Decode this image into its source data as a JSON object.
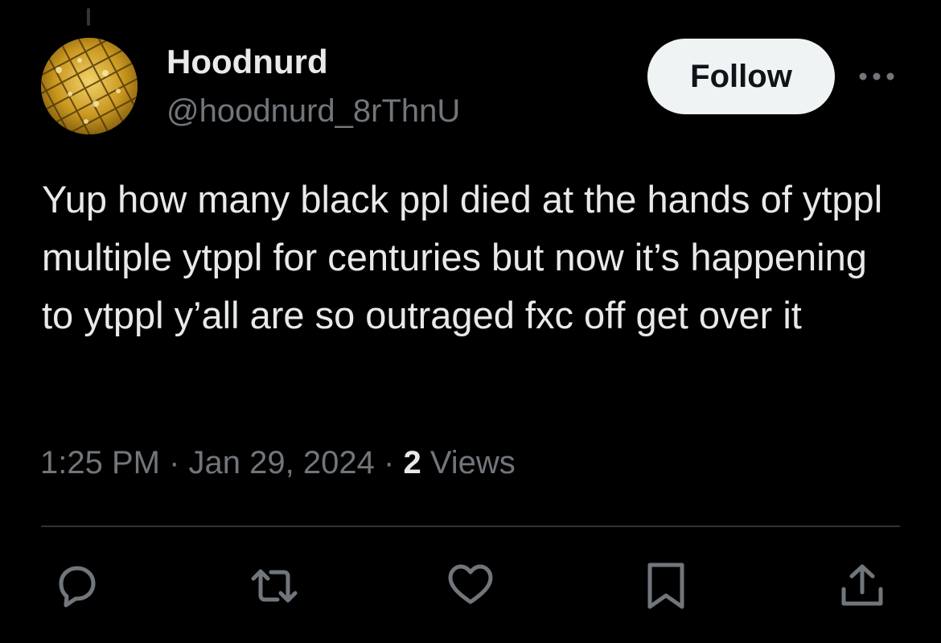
{
  "tweet": {
    "author": {
      "display_name": "Hoodnurd",
      "handle": "@hoodnurd_8rThnU",
      "avatar_icon": "gold-lottery-grid-avatar"
    },
    "follow_label": "Follow",
    "text": "Yup how many black ppl died at the hands of ytppl multiple ytppl for centuries but now it’s happening to ytppl y’all are so outraged fxc off get over it",
    "time": "1:25 PM",
    "separator": "·",
    "date": "Jan 29, 2024",
    "views_count": "2",
    "views_label": "Views"
  },
  "actions": [
    {
      "name": "reply",
      "icon": "speech-bubble-icon"
    },
    {
      "name": "repost",
      "icon": "repost-arrows-icon"
    },
    {
      "name": "like",
      "icon": "heart-icon"
    },
    {
      "name": "bookmark",
      "icon": "bookmark-icon"
    },
    {
      "name": "share",
      "icon": "share-upload-icon"
    }
  ],
  "colors": {
    "background": "#000000",
    "primary_text": "#e7e9ea",
    "secondary_text": "#71767b",
    "follow_button_bg": "#eff3f4",
    "divider": "#2f3336"
  }
}
